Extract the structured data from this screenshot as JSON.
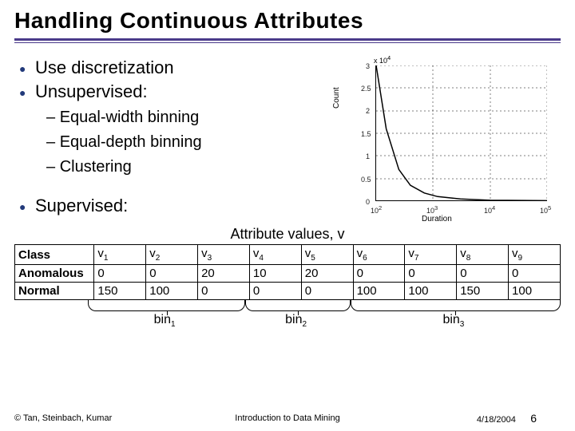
{
  "title": "Handling Continuous Attributes",
  "bullets": {
    "b1": "Use discretization",
    "b2": "Unsupervised:",
    "sub1": "Equal-width binning",
    "sub2": "Equal-depth binning",
    "sub3": "Clustering",
    "b3": "Supervised:"
  },
  "table": {
    "caption": "Attribute values, v",
    "class_header": "Class",
    "col_prefix": "v",
    "cols": [
      "1",
      "2",
      "3",
      "4",
      "5",
      "6",
      "7",
      "8",
      "9"
    ],
    "rows": [
      {
        "label": "Anomalous",
        "vals": [
          "0",
          "0",
          "20",
          "10",
          "20",
          "0",
          "0",
          "0",
          "0"
        ]
      },
      {
        "label": "Normal",
        "vals": [
          "150",
          "100",
          "0",
          "0",
          "0",
          "100",
          "100",
          "150",
          "100"
        ]
      }
    ]
  },
  "bins": {
    "prefix": "bin",
    "labels": [
      "1",
      "2",
      "3"
    ]
  },
  "chart_data": {
    "type": "line",
    "xlabel": "Duration",
    "ylabel": "Count",
    "xscale": "log",
    "xlim": [
      100,
      100000
    ],
    "ylim": [
      0,
      3
    ],
    "y_scale_exponent": 4,
    "y_scale_text": "x 10",
    "xticks": [
      100,
      1000,
      10000,
      100000
    ],
    "xtick_labels": [
      "10^2",
      "10^3",
      "10^4",
      "10^5"
    ],
    "yticks": [
      0,
      0.5,
      1,
      1.5,
      2,
      2.5,
      3
    ],
    "series": [
      {
        "name": "count",
        "x": [
          100,
          150,
          250,
          400,
          700,
          1200,
          3000,
          10000,
          100000
        ],
        "y": [
          3.0,
          1.6,
          0.7,
          0.35,
          0.18,
          0.1,
          0.05,
          0.02,
          0.01
        ]
      }
    ]
  },
  "footer": {
    "left": "© Tan, Steinbach, Kumar",
    "center": "Introduction to Data Mining",
    "right": "4/18/2004",
    "page": "6"
  }
}
